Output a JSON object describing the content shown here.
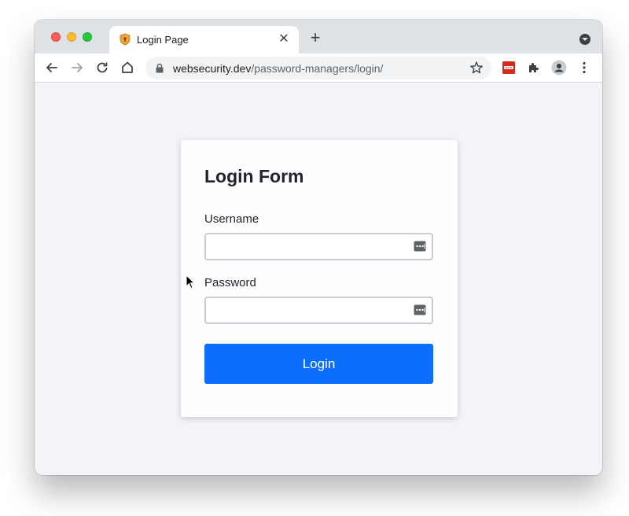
{
  "browser": {
    "tab": {
      "title": "Login Page",
      "close_glyph": "✕",
      "favicon": "shield-icon"
    },
    "new_tab_glyph": "+",
    "address_bar": {
      "host": "websecurity.dev",
      "path": "/password-managers/login/"
    }
  },
  "form": {
    "title": "Login Form",
    "username": {
      "label": "Username",
      "value": ""
    },
    "password": {
      "label": "Password",
      "value": ""
    },
    "submit_label": "Login"
  },
  "colors": {
    "primary_button": "#0d6efd",
    "page_background": "#f3f4f9",
    "extension_badge": "#d52b1e"
  }
}
